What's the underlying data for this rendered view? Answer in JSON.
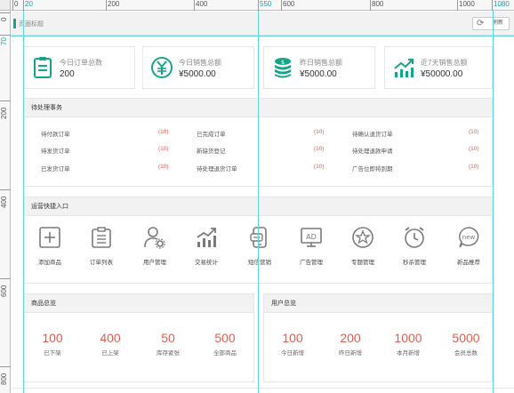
{
  "ruler": {
    "top_labels": [
      "0",
      "20",
      "200",
      "400",
      "550",
      "600",
      "800",
      "1000",
      "1080"
    ],
    "left_labels": [
      "0",
      "70",
      "200",
      "400",
      "600",
      "800"
    ]
  },
  "header": {
    "breadcrumb": "页面标题",
    "refresh_label": "刷新"
  },
  "stats": [
    {
      "title": "今日订单总数",
      "value": "200",
      "icon": "order-list-icon"
    },
    {
      "title": "今日销售总额",
      "value": "¥5000.00",
      "icon": "yen-icon"
    },
    {
      "title": "昨日销售总额",
      "value": "¥5000.00",
      "icon": "coins-icon"
    },
    {
      "title": "近7天销售总额",
      "value": "¥50000.00",
      "icon": "trend-chart-icon"
    }
  ],
  "pending": {
    "title": "待处理事务",
    "items": [
      {
        "label": "待付款订单",
        "count": "(10)"
      },
      {
        "label": "已完成订单",
        "count": "(10)"
      },
      {
        "label": "待确认退货订单",
        "count": "(10)"
      },
      {
        "label": "待发货订单",
        "count": "(10)"
      },
      {
        "label": "新缺货登记",
        "count": "(10)"
      },
      {
        "label": "待处理退款申请",
        "count": "(10)"
      },
      {
        "label": "已发货订单",
        "count": "(10)"
      },
      {
        "label": "待处理退货订单",
        "count": "(10)"
      },
      {
        "label": "广告位即将到期",
        "count": "(10)"
      }
    ]
  },
  "quick": {
    "title": "运营快捷入口",
    "items": [
      {
        "label": "添加商品",
        "icon": "plus-box-icon"
      },
      {
        "label": "订单列表",
        "icon": "clipboard-icon"
      },
      {
        "label": "用户管理",
        "icon": "user-gear-icon"
      },
      {
        "label": "交易统计",
        "icon": "bar-chart-icon"
      },
      {
        "label": "短信营销",
        "icon": "phone-message-icon"
      },
      {
        "label": "广告管理",
        "icon": "ad-screen-icon"
      },
      {
        "label": "专题管理",
        "icon": "star-circle-icon"
      },
      {
        "label": "秒杀管理",
        "icon": "alarm-clock-icon"
      },
      {
        "label": "新品推荐",
        "icon": "new-badge-icon"
      }
    ]
  },
  "product_overview": {
    "title": "商品总览",
    "items": [
      {
        "value": "100",
        "label": "已下架"
      },
      {
        "value": "400",
        "label": "已上架"
      },
      {
        "value": "50",
        "label": "库存紧张"
      },
      {
        "value": "500",
        "label": "全部商品"
      }
    ]
  },
  "user_overview": {
    "title": "用户总览",
    "items": [
      {
        "value": "100",
        "label": "今日新增"
      },
      {
        "value": "200",
        "label": "昨日新增"
      },
      {
        "value": "1000",
        "label": "本月新增"
      },
      {
        "value": "5000",
        "label": "会员总数"
      }
    ]
  },
  "colors": {
    "accent_green": "#17a589",
    "count_red": "#e05d4d",
    "guide_cyan": "#5cd6e0",
    "icon_gray": "#7a7a7a"
  }
}
